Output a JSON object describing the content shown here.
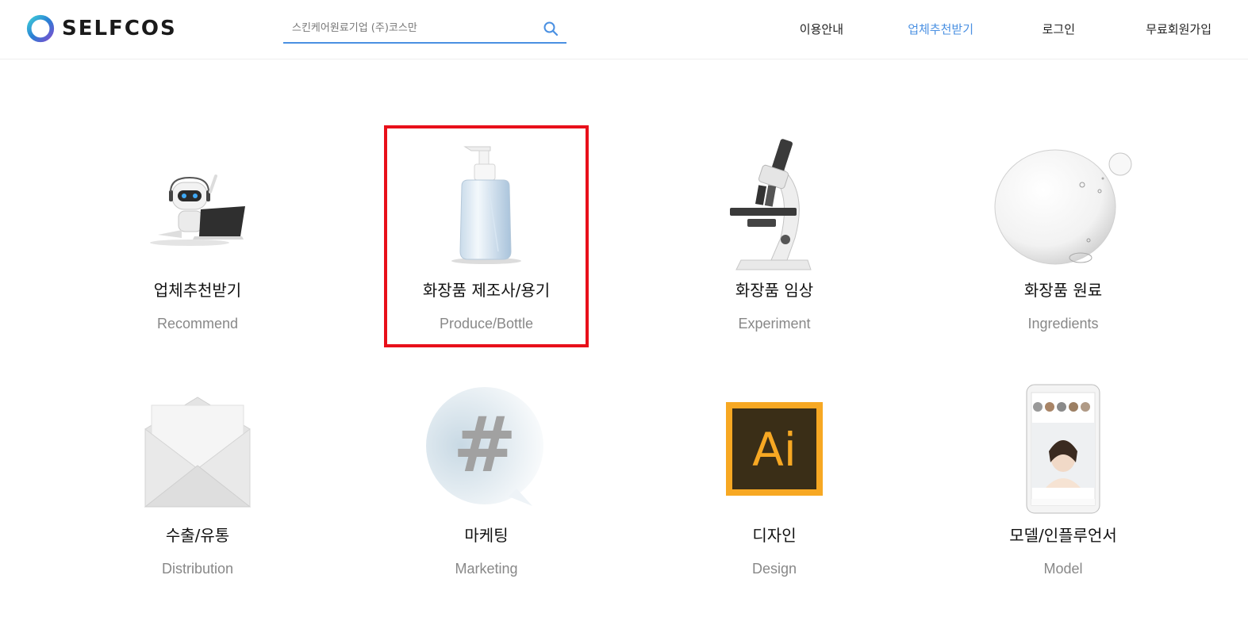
{
  "logo": {
    "text": "SELFCOS"
  },
  "search": {
    "placeholder": "스킨케어원료기업 (주)코스만"
  },
  "nav": {
    "items": [
      {
        "label": "이용안내"
      },
      {
        "label": "업체추천받기"
      },
      {
        "label": "로그인"
      },
      {
        "label": "무료회원가입"
      }
    ]
  },
  "colors": {
    "accent": "#4a90e2",
    "highlight": "#e8101a"
  },
  "categories": [
    {
      "title": "업체추천받기",
      "subtitle": "Recommend",
      "icon": "robot-laptop-icon"
    },
    {
      "title": "화장품 제조사/용기",
      "subtitle": "Produce/Bottle",
      "icon": "pump-bottle-icon"
    },
    {
      "title": "화장품 임상",
      "subtitle": "Experiment",
      "icon": "microscope-icon"
    },
    {
      "title": "화장품 원료",
      "subtitle": "Ingredients",
      "icon": "water-droplet-icon"
    },
    {
      "title": "수출/유통",
      "subtitle": "Distribution",
      "icon": "envelope-icon"
    },
    {
      "title": "마케팅",
      "subtitle": "Marketing",
      "icon": "hashtag-bubble-icon"
    },
    {
      "title": "디자인",
      "subtitle": "Design",
      "icon": "illustrator-icon",
      "icon_text": "Ai"
    },
    {
      "title": "모델/인플루언서",
      "subtitle": "Model",
      "icon": "smartphone-model-icon"
    }
  ]
}
